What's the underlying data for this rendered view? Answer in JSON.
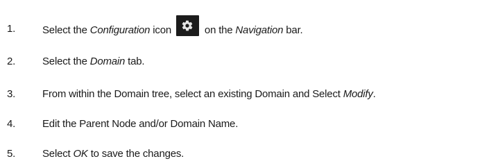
{
  "steps": [
    {
      "number": "1.",
      "parts": {
        "a": "Select the ",
        "b": "Configuration",
        "c": " icon ",
        "d": " on the ",
        "e": "Navigation",
        "f": " bar."
      },
      "icon": "gear-icon"
    },
    {
      "number": "2.",
      "parts": {
        "a": "Select the ",
        "b": "Domain",
        "c": " tab."
      }
    },
    {
      "number": "3.",
      "parts": {
        "a": "From within the Domain tree, select an existing Domain and Select ",
        "b": "Modify",
        "c": "."
      }
    },
    {
      "number": "4.",
      "parts": {
        "a": "Edit the Parent Node and/or Domain Name."
      }
    },
    {
      "number": "5.",
      "parts": {
        "a": "Select ",
        "b": "OK",
        "c": " to save the changes."
      }
    }
  ],
  "colors": {
    "text": "#1a1a1a",
    "icon_bg": "#1c1c1c",
    "icon_fg": "#e6e6e6"
  }
}
